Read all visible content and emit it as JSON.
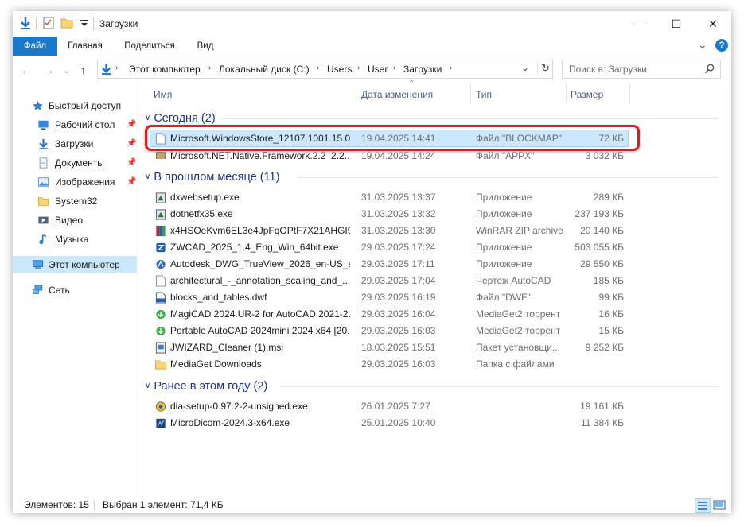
{
  "window": {
    "title": "Загрузки",
    "minimize_glyph": "—",
    "maximize_glyph": "☐",
    "close_glyph": "✕"
  },
  "ribbon": {
    "tabs": [
      "Файл",
      "Главная",
      "Поделиться",
      "Вид"
    ],
    "collapse_glyph": "⌄",
    "help_glyph": "?"
  },
  "nav": {
    "back": "←",
    "forward": "→",
    "recent": "⌄",
    "up": "↑"
  },
  "address": {
    "crumbs": [
      "Этот компьютер",
      "Локальный диск (C:)",
      "Users",
      "User",
      "Загрузки"
    ],
    "sep": "›",
    "dropdown": "⌄",
    "refresh": "↻"
  },
  "search": {
    "placeholder": "Поиск в: Загрузки",
    "icon": "search-icon"
  },
  "navpane": {
    "quick_access": "Быстрый доступ",
    "items": [
      {
        "label": "Рабочий стол",
        "icon": "desktop-icon",
        "pinned": true
      },
      {
        "label": "Загрузки",
        "icon": "download-icon",
        "pinned": true
      },
      {
        "label": "Документы",
        "icon": "documents-icon",
        "pinned": true
      },
      {
        "label": "Изображения",
        "icon": "pictures-icon",
        "pinned": true
      },
      {
        "label": "System32",
        "icon": "folder-icon",
        "pinned": false
      },
      {
        "label": "Видео",
        "icon": "video-icon",
        "pinned": false
      },
      {
        "label": "Музыка",
        "icon": "music-icon",
        "pinned": false
      }
    ],
    "this_pc": "Этот компьютер",
    "network": "Сеть",
    "pin_glyph": "📌"
  },
  "columns": {
    "name": "Имя",
    "date": "Дата изменения",
    "type": "Тип",
    "size": "Размер",
    "sort_glyph": "⌃"
  },
  "groups": [
    {
      "title": "Сегодня (2)",
      "files": [
        {
          "name": "Microsoft.WindowsStore_12107.1001.15.0...",
          "date": "19.04.2025 14:41",
          "type": "Файл \"BLOCKMAP\"",
          "size": "72 КБ",
          "icon": "blank-file-icon",
          "selected": true
        },
        {
          "name": "Microsoft.NET.Native.Framework.2.2_2.2...",
          "date": "19.04.2025 14:24",
          "type": "Файл \"APPX\"",
          "size": "3 032 КБ",
          "icon": "package-icon",
          "selected": false
        }
      ]
    },
    {
      "title": "В прошлом месяце (11)",
      "files": [
        {
          "name": "dxwebsetup.exe",
          "date": "31.03.2025 13:37",
          "type": "Приложение",
          "size": "289 КБ",
          "icon": "setup-exe-icon"
        },
        {
          "name": "dotnetfx35.exe",
          "date": "31.03.2025 13:32",
          "type": "Приложение",
          "size": "237 193 КБ",
          "icon": "setup-exe-icon"
        },
        {
          "name": "x4HSOeKvm6EL3e4JpFqOPtF7X21AHGI9....",
          "date": "31.03.2025 13:30",
          "type": "WinRAR ZIP archive",
          "size": "20 140 КБ",
          "icon": "winrar-icon"
        },
        {
          "name": "ZWCAD_2025_1.4_Eng_Win_64bit.exe",
          "date": "29.03.2025 17:24",
          "type": "Приложение",
          "size": "503 055 КБ",
          "icon": "zwcad-icon"
        },
        {
          "name": "Autodesk_DWG_TrueView_2026_en-US_se...",
          "date": "29.03.2025 17:11",
          "type": "Приложение",
          "size": "29 550 КБ",
          "icon": "autodesk-icon"
        },
        {
          "name": "architectural_-_annotation_scaling_and_...",
          "date": "29.03.2025 17:04",
          "type": "Чертеж AutoCAD",
          "size": "185 КБ",
          "icon": "blank-file-icon"
        },
        {
          "name": "blocks_and_tables.dwf",
          "date": "29.03.2025 16:19",
          "type": "Файл \"DWF\"",
          "size": "99 КБ",
          "icon": "dwf-icon"
        },
        {
          "name": "MagiCAD 2024.UR-2 for AutoCAD 2021-2...",
          "date": "29.03.2025 16:04",
          "type": "MediaGet2 торрент",
          "size": "16 КБ",
          "icon": "mediaget-icon"
        },
        {
          "name": "Portable AutoCAD 2024mini 2024 x64 [20...",
          "date": "29.03.2025 16:03",
          "type": "MediaGet2 торрент",
          "size": "15 КБ",
          "icon": "mediaget-icon"
        },
        {
          "name": "JWIZARD_Cleaner (1).msi",
          "date": "18.03.2025 15:51",
          "type": "Пакет установщи...",
          "size": "9 252 КБ",
          "icon": "msi-icon"
        },
        {
          "name": "MediaGet Downloads",
          "date": "29.03.2025 16:03",
          "type": "Папка с файлами",
          "size": "",
          "icon": "folder-icon"
        }
      ]
    },
    {
      "title": "Ранее в этом году (2)",
      "files": [
        {
          "name": "dia-setup-0.97.2-2-unsigned.exe",
          "date": "26.01.2025 7:27",
          "type": "",
          "size": "19 161 КБ",
          "icon": "dia-icon"
        },
        {
          "name": "MicroDicom-2024.3-x64.exe",
          "date": "25.01.2025 10:40",
          "type": "",
          "size": "11 384 КБ",
          "icon": "microdicom-icon"
        }
      ]
    }
  ],
  "status": {
    "count": "Элементов: 15",
    "selection": "Выбран 1 элемент: 71,4 КБ"
  },
  "colors": {
    "accent": "#1979ca",
    "selection": "#cce8ff",
    "highlight_ring": "#e21a1a",
    "group_text": "#1e3287"
  }
}
